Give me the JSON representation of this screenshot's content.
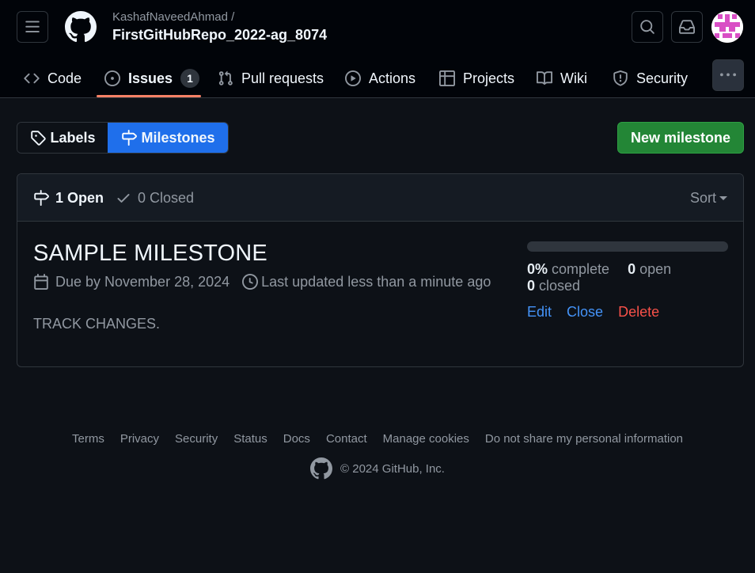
{
  "header": {
    "owner": "KashafNaveedAhmad /",
    "repo": "FirstGitHubRepo_2022-ag_8074"
  },
  "nav": {
    "tabs": [
      {
        "label": "Code",
        "icon": "code-icon"
      },
      {
        "label": "Issues",
        "icon": "issue-opened-icon",
        "counter": "1"
      },
      {
        "label": "Pull requests",
        "icon": "git-pull-request-icon"
      },
      {
        "label": "Actions",
        "icon": "play-icon"
      },
      {
        "label": "Projects",
        "icon": "table-icon"
      },
      {
        "label": "Wiki",
        "icon": "book-icon"
      },
      {
        "label": "Security",
        "icon": "shield-icon"
      }
    ],
    "selected": "Issues"
  },
  "toolbar": {
    "labels_label": "Labels",
    "milestones_label": "Milestones",
    "new_milestone_label": "New milestone"
  },
  "states": {
    "open_label": "1 Open",
    "closed_label": "0 Closed",
    "sort_label": "Sort"
  },
  "milestone": {
    "title": "SAMPLE MILESTONE",
    "due": "Due by November 28, 2024",
    "updated": "Last updated less than a minute ago",
    "description": "TRACK CHANGES.",
    "progress_percent": 0,
    "complete_value": "0%",
    "complete_label": "complete",
    "open_value": "0",
    "open_label": "open",
    "closed_value": "0",
    "closed_label": "closed",
    "edit_label": "Edit",
    "close_label": "Close",
    "delete_label": "Delete"
  },
  "footer": {
    "links": [
      "Terms",
      "Privacy",
      "Security",
      "Status",
      "Docs",
      "Contact",
      "Manage cookies",
      "Do not share my personal information"
    ],
    "copyright": "© 2024 GitHub, Inc."
  },
  "colors": {
    "background": "#0d1117",
    "header_background": "#010409",
    "accent_blue": "#1f6feb",
    "primary_green": "#238636",
    "danger_red": "#f85149",
    "tab_underline": "#f78166"
  }
}
